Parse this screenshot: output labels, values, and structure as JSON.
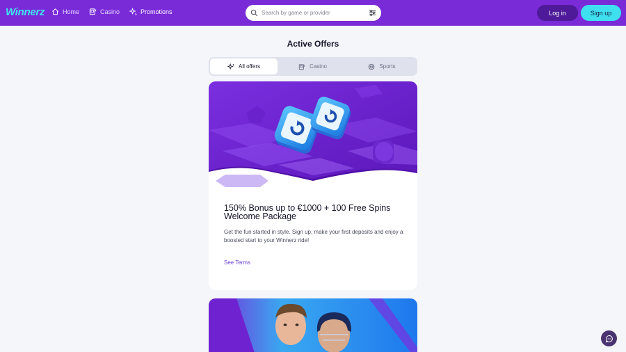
{
  "header": {
    "logo": "Winnerz",
    "nav": {
      "home": "Home",
      "casino": "Casino",
      "promotions": "Promotions"
    },
    "search": {
      "placeholder": "Search by game or provider"
    },
    "login_label": "Log in",
    "signup_label": "Sign up"
  },
  "page": {
    "title": "Active Offers"
  },
  "tabs": {
    "all": "All offers",
    "casino": "Casino",
    "sports": "Sports",
    "selected": "All offers"
  },
  "offer": {
    "title": "150% Bonus up to €1000 + 100 Free Spins Welcome Package",
    "description": "Get the fun started in style. Sign up, make your first deposits and enjoy a boosted start to your Winnerz ride!",
    "terms_label": "See Terms"
  },
  "colors": {
    "header_bg": "#7a2bd8",
    "accent_cyan": "#3ee0f0",
    "login_bg": "#4e1a99",
    "link": "#6a3fd6",
    "page_bg": "#f5f6fa"
  },
  "icons": {
    "home": "home-icon",
    "casino": "slot-machine-icon",
    "promotions": "sparkle-icon",
    "search": "search-icon",
    "filter": "filter-icon",
    "sports": "ball-icon",
    "chat": "chat-icon"
  }
}
